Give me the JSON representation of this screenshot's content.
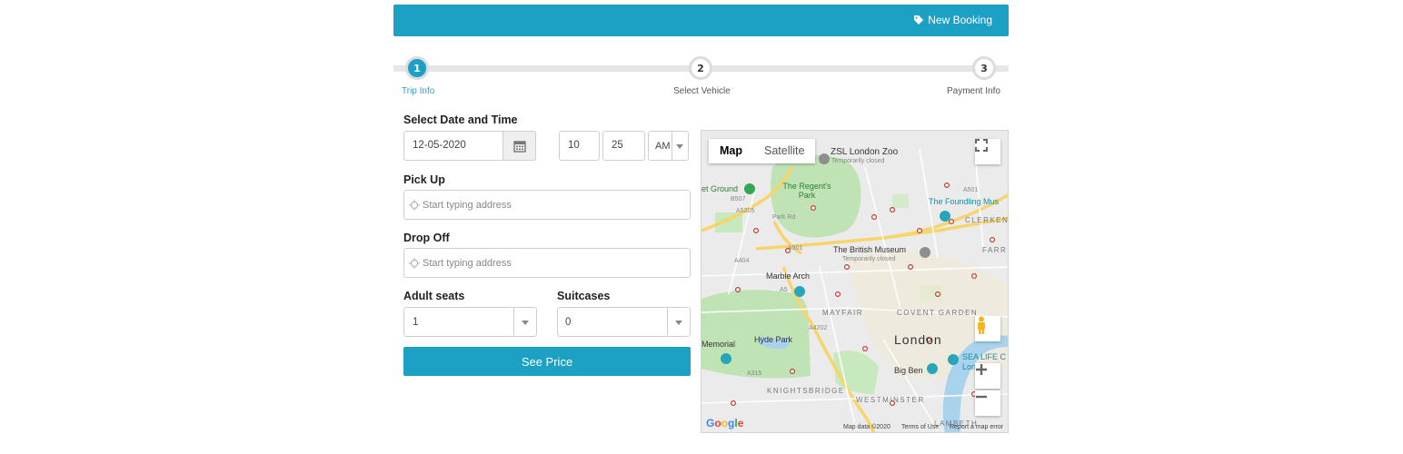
{
  "header": {
    "new_booking_label": "New Booking",
    "accent": "#1ca0c4"
  },
  "steps": [
    {
      "number": "1",
      "label": "Trip Info",
      "state": "active"
    },
    {
      "number": "2",
      "label": "Select Vehicle",
      "state": "inactive"
    },
    {
      "number": "3",
      "label": "Payment Info",
      "state": "inactive"
    }
  ],
  "form": {
    "date_time_label": "Select Date and Time",
    "date_value": "12-05-2020",
    "hour_value": "10",
    "minute_value": "25",
    "ampm_value": "AM",
    "pickup_label": "Pick Up",
    "pickup_placeholder": "Start typing address",
    "dropoff_label": "Drop Off",
    "dropoff_placeholder": "Start typing address",
    "adult_seats_label": "Adult seats",
    "adult_seats_value": "1",
    "suitcases_label": "Suitcases",
    "suitcases_value": "0",
    "see_price_label": "See Price"
  },
  "map": {
    "type_map": "Map",
    "type_satellite": "Satellite",
    "labels": {
      "zoo": "ZSL London Zoo",
      "zoo_status": "Temporarily closed",
      "regents_park": "The Regent's Park",
      "ground": "et Ground",
      "foundling": "The Foundling Mus",
      "clerken": "CLERKEN",
      "british_museum": "The British Museum",
      "bm_status": "Temporarily closed",
      "farr": "FARRI",
      "marble_arch": "Marble Arch",
      "mayfair": "MAYFAIR",
      "covent_garden": "COVENT GARDEN",
      "london": "London",
      "memorial": "Memorial",
      "hyde_park": "Hyde Park",
      "big_ben": "Big Ben",
      "sea_life": "SEA LIFE C",
      "sea_life_2": "Lon",
      "knightsbridge": "KNIGHTSBRIDGE",
      "westminster": "WESTMINSTER",
      "lambeth": "LAMBETH",
      "a501": "A501",
      "a501b": "A501",
      "a5205": "A5205",
      "park_rd": "Park Rd",
      "a5": "A5",
      "a4202": "A4202",
      "a404": "A404",
      "a315": "A315",
      "b507": "B507"
    },
    "google": "Google",
    "map_data": "Map data ©2020",
    "terms": "Terms of Use",
    "report": "Report a map error"
  }
}
